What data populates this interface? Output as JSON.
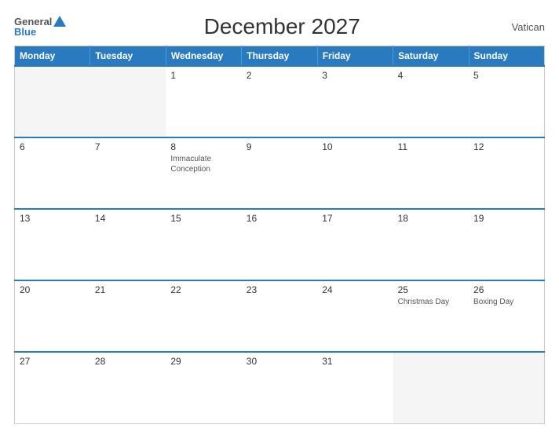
{
  "header": {
    "logo_general": "General",
    "logo_blue": "Blue",
    "title": "December 2027",
    "country": "Vatican"
  },
  "calendar": {
    "columns": [
      "Monday",
      "Tuesday",
      "Wednesday",
      "Thursday",
      "Friday",
      "Saturday",
      "Sunday"
    ],
    "rows": [
      [
        {
          "num": "",
          "holiday": "",
          "empty": true
        },
        {
          "num": "",
          "holiday": "",
          "empty": true
        },
        {
          "num": "1",
          "holiday": ""
        },
        {
          "num": "2",
          "holiday": ""
        },
        {
          "num": "3",
          "holiday": ""
        },
        {
          "num": "4",
          "holiday": ""
        },
        {
          "num": "5",
          "holiday": ""
        }
      ],
      [
        {
          "num": "6",
          "holiday": ""
        },
        {
          "num": "7",
          "holiday": ""
        },
        {
          "num": "8",
          "holiday": "Immaculate\nConception"
        },
        {
          "num": "9",
          "holiday": ""
        },
        {
          "num": "10",
          "holiday": ""
        },
        {
          "num": "11",
          "holiday": ""
        },
        {
          "num": "12",
          "holiday": ""
        }
      ],
      [
        {
          "num": "13",
          "holiday": ""
        },
        {
          "num": "14",
          "holiday": ""
        },
        {
          "num": "15",
          "holiday": ""
        },
        {
          "num": "16",
          "holiday": ""
        },
        {
          "num": "17",
          "holiday": ""
        },
        {
          "num": "18",
          "holiday": ""
        },
        {
          "num": "19",
          "holiday": ""
        }
      ],
      [
        {
          "num": "20",
          "holiday": ""
        },
        {
          "num": "21",
          "holiday": ""
        },
        {
          "num": "22",
          "holiday": ""
        },
        {
          "num": "23",
          "holiday": ""
        },
        {
          "num": "24",
          "holiday": ""
        },
        {
          "num": "25",
          "holiday": "Christmas Day"
        },
        {
          "num": "26",
          "holiday": "Boxing Day"
        }
      ],
      [
        {
          "num": "27",
          "holiday": ""
        },
        {
          "num": "28",
          "holiday": ""
        },
        {
          "num": "29",
          "holiday": ""
        },
        {
          "num": "30",
          "holiday": ""
        },
        {
          "num": "31",
          "holiday": ""
        },
        {
          "num": "",
          "holiday": "",
          "empty": true
        },
        {
          "num": "",
          "holiday": "",
          "empty": true
        }
      ]
    ]
  }
}
